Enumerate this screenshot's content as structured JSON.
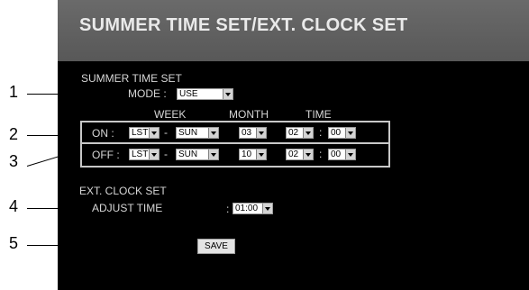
{
  "header": {
    "title": "SUMMER TIME SET/EXT. CLOCK SET"
  },
  "summer": {
    "section_label": "SUMMER TIME SET",
    "mode_label": "MODE :",
    "mode_value": "USE",
    "col_week": "WEEK",
    "col_month": "MONTH",
    "col_time": "TIME",
    "on": {
      "label": "ON  :",
      "week": "LST",
      "day": "SUN",
      "month": "03",
      "hour": "02",
      "minute": "00"
    },
    "off": {
      "label": "OFF :",
      "week": "LST",
      "day": "SUN",
      "month": "10",
      "hour": "02",
      "minute": "00"
    },
    "dash": "-",
    "colon": ":"
  },
  "ext": {
    "section_label": "EXT. CLOCK SET",
    "adjust_label": "ADJUST TIME",
    "adjust_colon": ":",
    "adjust_value": "01:00"
  },
  "save_label": "SAVE",
  "callouts": [
    "1",
    "2",
    "3",
    "4",
    "5"
  ]
}
